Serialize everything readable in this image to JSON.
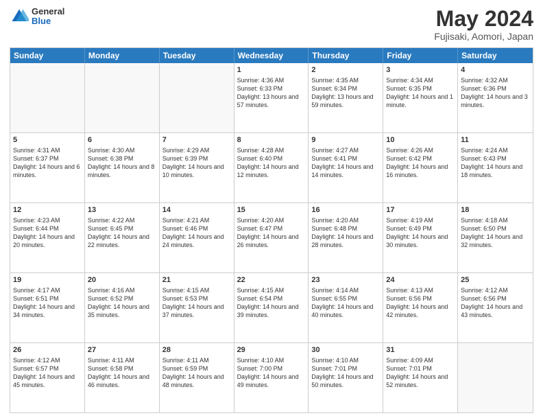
{
  "header": {
    "logo_general": "General",
    "logo_blue": "Blue",
    "month_title": "May 2024",
    "location": "Fujisaki, Aomori, Japan"
  },
  "weekdays": [
    "Sunday",
    "Monday",
    "Tuesday",
    "Wednesday",
    "Thursday",
    "Friday",
    "Saturday"
  ],
  "rows": [
    [
      {
        "day": "",
        "info": ""
      },
      {
        "day": "",
        "info": ""
      },
      {
        "day": "",
        "info": ""
      },
      {
        "day": "1",
        "info": "Sunrise: 4:36 AM\nSunset: 6:33 PM\nDaylight: 13 hours and 57 minutes."
      },
      {
        "day": "2",
        "info": "Sunrise: 4:35 AM\nSunset: 6:34 PM\nDaylight: 13 hours and 59 minutes."
      },
      {
        "day": "3",
        "info": "Sunrise: 4:34 AM\nSunset: 6:35 PM\nDaylight: 14 hours and 1 minute."
      },
      {
        "day": "4",
        "info": "Sunrise: 4:32 AM\nSunset: 6:36 PM\nDaylight: 14 hours and 3 minutes."
      }
    ],
    [
      {
        "day": "5",
        "info": "Sunrise: 4:31 AM\nSunset: 6:37 PM\nDaylight: 14 hours and 6 minutes."
      },
      {
        "day": "6",
        "info": "Sunrise: 4:30 AM\nSunset: 6:38 PM\nDaylight: 14 hours and 8 minutes."
      },
      {
        "day": "7",
        "info": "Sunrise: 4:29 AM\nSunset: 6:39 PM\nDaylight: 14 hours and 10 minutes."
      },
      {
        "day": "8",
        "info": "Sunrise: 4:28 AM\nSunset: 6:40 PM\nDaylight: 14 hours and 12 minutes."
      },
      {
        "day": "9",
        "info": "Sunrise: 4:27 AM\nSunset: 6:41 PM\nDaylight: 14 hours and 14 minutes."
      },
      {
        "day": "10",
        "info": "Sunrise: 4:26 AM\nSunset: 6:42 PM\nDaylight: 14 hours and 16 minutes."
      },
      {
        "day": "11",
        "info": "Sunrise: 4:24 AM\nSunset: 6:43 PM\nDaylight: 14 hours and 18 minutes."
      }
    ],
    [
      {
        "day": "12",
        "info": "Sunrise: 4:23 AM\nSunset: 6:44 PM\nDaylight: 14 hours and 20 minutes."
      },
      {
        "day": "13",
        "info": "Sunrise: 4:22 AM\nSunset: 6:45 PM\nDaylight: 14 hours and 22 minutes."
      },
      {
        "day": "14",
        "info": "Sunrise: 4:21 AM\nSunset: 6:46 PM\nDaylight: 14 hours and 24 minutes."
      },
      {
        "day": "15",
        "info": "Sunrise: 4:20 AM\nSunset: 6:47 PM\nDaylight: 14 hours and 26 minutes."
      },
      {
        "day": "16",
        "info": "Sunrise: 4:20 AM\nSunset: 6:48 PM\nDaylight: 14 hours and 28 minutes."
      },
      {
        "day": "17",
        "info": "Sunrise: 4:19 AM\nSunset: 6:49 PM\nDaylight: 14 hours and 30 minutes."
      },
      {
        "day": "18",
        "info": "Sunrise: 4:18 AM\nSunset: 6:50 PM\nDaylight: 14 hours and 32 minutes."
      }
    ],
    [
      {
        "day": "19",
        "info": "Sunrise: 4:17 AM\nSunset: 6:51 PM\nDaylight: 14 hours and 34 minutes."
      },
      {
        "day": "20",
        "info": "Sunrise: 4:16 AM\nSunset: 6:52 PM\nDaylight: 14 hours and 35 minutes."
      },
      {
        "day": "21",
        "info": "Sunrise: 4:15 AM\nSunset: 6:53 PM\nDaylight: 14 hours and 37 minutes."
      },
      {
        "day": "22",
        "info": "Sunrise: 4:15 AM\nSunset: 6:54 PM\nDaylight: 14 hours and 39 minutes."
      },
      {
        "day": "23",
        "info": "Sunrise: 4:14 AM\nSunset: 6:55 PM\nDaylight: 14 hours and 40 minutes."
      },
      {
        "day": "24",
        "info": "Sunrise: 4:13 AM\nSunset: 6:56 PM\nDaylight: 14 hours and 42 minutes."
      },
      {
        "day": "25",
        "info": "Sunrise: 4:12 AM\nSunset: 6:56 PM\nDaylight: 14 hours and 43 minutes."
      }
    ],
    [
      {
        "day": "26",
        "info": "Sunrise: 4:12 AM\nSunset: 6:57 PM\nDaylight: 14 hours and 45 minutes."
      },
      {
        "day": "27",
        "info": "Sunrise: 4:11 AM\nSunset: 6:58 PM\nDaylight: 14 hours and 46 minutes."
      },
      {
        "day": "28",
        "info": "Sunrise: 4:11 AM\nSunset: 6:59 PM\nDaylight: 14 hours and 48 minutes."
      },
      {
        "day": "29",
        "info": "Sunrise: 4:10 AM\nSunset: 7:00 PM\nDaylight: 14 hours and 49 minutes."
      },
      {
        "day": "30",
        "info": "Sunrise: 4:10 AM\nSunset: 7:01 PM\nDaylight: 14 hours and 50 minutes."
      },
      {
        "day": "31",
        "info": "Sunrise: 4:09 AM\nSunset: 7:01 PM\nDaylight: 14 hours and 52 minutes."
      },
      {
        "day": "",
        "info": ""
      }
    ]
  ]
}
